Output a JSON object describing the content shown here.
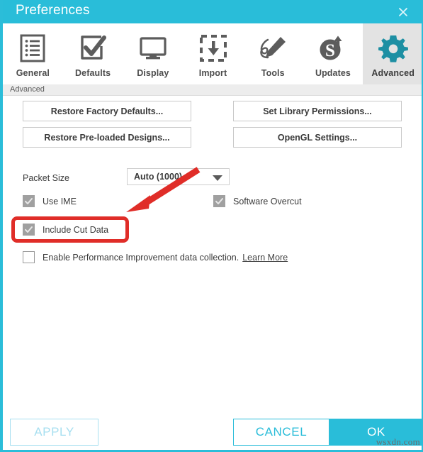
{
  "window": {
    "title": "Preferences",
    "close_icon": "close-icon",
    "accent_color": "#29bdd9"
  },
  "tabs": [
    {
      "label": "General",
      "icon": "list-icon",
      "selected": false
    },
    {
      "label": "Defaults",
      "icon": "checkbox-icon",
      "selected": false
    },
    {
      "label": "Display",
      "icon": "monitor-icon",
      "selected": false
    },
    {
      "label": "Import",
      "icon": "import-box-icon",
      "selected": false
    },
    {
      "label": "Tools",
      "icon": "pencil-icon",
      "selected": false
    },
    {
      "label": "Updates",
      "icon": "update-s-icon",
      "selected": false
    },
    {
      "label": "Advanced",
      "icon": "gear-icon",
      "selected": true
    }
  ],
  "section": {
    "label": "Advanced"
  },
  "buttons": {
    "restore_factory_defaults": "Restore Factory Defaults...",
    "restore_preloaded_designs": "Restore Pre-loaded Designs...",
    "set_library_permissions": "Set Library Permissions...",
    "opengl_settings": "OpenGL Settings..."
  },
  "packet_size": {
    "label": "Packet Size",
    "value": "Auto (1000)",
    "arrow_icon": "chevron-down-icon"
  },
  "checkboxes": [
    {
      "name": "use-ime",
      "label": "Use IME",
      "checked": true,
      "enabled": false
    },
    {
      "name": "software-overcut",
      "label": "Software Overcut",
      "checked": true,
      "enabled": false
    },
    {
      "name": "include-cut-data",
      "label": "Include Cut Data",
      "checked": true,
      "enabled": false
    },
    {
      "name": "enable-performance",
      "label": "Enable Performance Improvement data collection.",
      "checked": false,
      "enabled": true
    }
  ],
  "learn_more": {
    "label": "Learn More"
  },
  "annotations": {
    "highlight_color": "#e02d28",
    "arrow_color": "#e02d28",
    "highlight_target": "include-cut-data",
    "arrow_points_to": "include-cut-data"
  },
  "footer": {
    "apply": "APPLY",
    "cancel": "CANCEL",
    "ok": "OK"
  },
  "watermark": {
    "text": "wsxdn.com"
  }
}
